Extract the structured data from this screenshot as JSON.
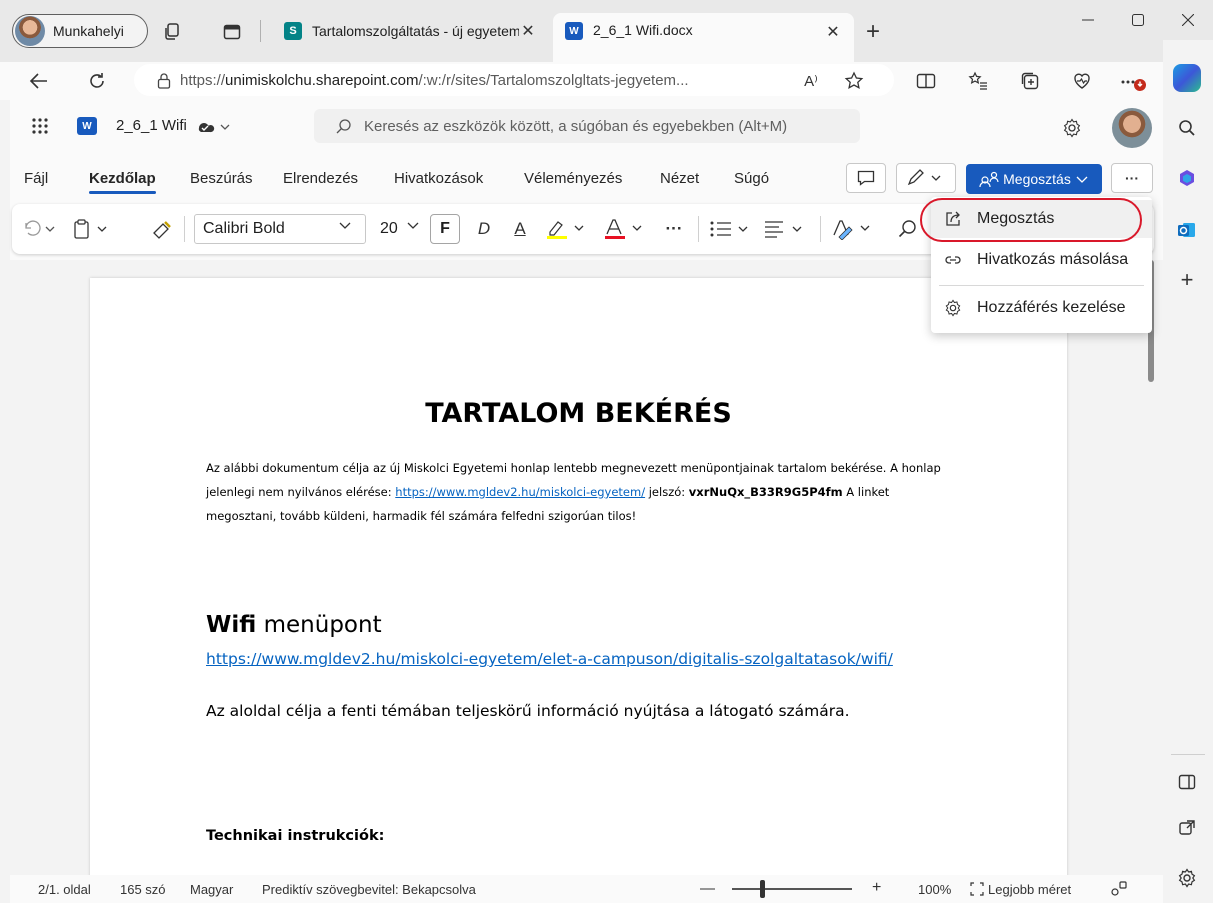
{
  "browser": {
    "profile_label": "Munkahelyi",
    "tabs": [
      {
        "title": "Tartalomszolgáltatás - új egyetem",
        "favicon": "sharepoint-icon",
        "active": false
      },
      {
        "title": "2_6_1 Wifi.docx",
        "favicon": "word-icon",
        "active": true
      }
    ],
    "new_tab": "+",
    "url_prefix": "https://",
    "url_domain": "unimiskolchu.sharepoint.com",
    "url_rest": "/:w:/r/sites/Tartalomszolgltats-jegyetem...",
    "read_aloud": "A⁾"
  },
  "word": {
    "doc_name": "2_6_1 Wifi",
    "search_placeholder": "Keresés az eszközök között, a súgóban és egyebekben (Alt+M)",
    "menu": [
      "Fájl",
      "Kezdőlap",
      "Beszúrás",
      "Elrendezés",
      "Hivatkozások",
      "Véleményezés",
      "Nézet",
      "Súgó"
    ],
    "share_label": "Megosztás",
    "more_label": "···",
    "font_name": "Calibri Bold",
    "font_size": "20",
    "bold_label": "F",
    "italic_label": "D",
    "underline_label": "A",
    "font_color_label": "A"
  },
  "dropdown": {
    "items": [
      "Megosztás",
      "Hivatkozás másolása",
      "Hozzáférés kezelése"
    ]
  },
  "document": {
    "title": "TARTALOM BEKÉRÉS",
    "intro_1": "Az alábbi dokumentum célja az új Miskolci Egyetemi honlap lentebb megnevezett menüpontjainak tartalom bekérése. A honlap jelenlegi nem nyilvános elérése: ",
    "intro_link": "https://www.mgldev2.hu/miskolci-egyetem/",
    "intro_2": " jelszó: ",
    "intro_pw": "vxrNuQx_B33R9G5P4fm",
    "intro_3": " A linket megosztani, tovább küldeni, harmadik fél számára felfedni szigorúan tilos!",
    "heading_bold": "Wifi",
    "heading_rest": " menüpont",
    "link": "https://www.mgldev2.hu/miskolci-egyetem/elet-a-campuson/digitalis-szolgaltatasok/wifi/",
    "paragraph": "Az aloldal célja a fenti témában teljeskörű információ nyújtása a látogató számára.",
    "subheading": "Technikai instrukciók:"
  },
  "status": {
    "page": "2/1. oldal",
    "words": "165 szó",
    "language": "Magyar",
    "predictive": "Prediktív szövegbevitel: Bekapcsolva",
    "zoom_minus": "—",
    "zoom_plus": "+",
    "zoom": "100%",
    "fit": "Legjobb méret"
  },
  "colors": {
    "accent": "#185abd",
    "highlight_red": "#d9182a"
  }
}
